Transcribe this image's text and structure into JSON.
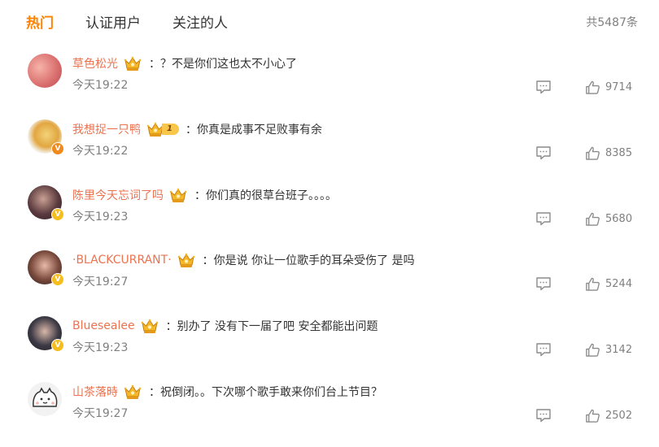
{
  "tabs": [
    {
      "label": "热门",
      "active": true
    },
    {
      "label": "认证用户",
      "active": false
    },
    {
      "label": "关注的人",
      "active": false
    }
  ],
  "total_count": "共5487条",
  "colors": {
    "accent": "#ff8200",
    "username": "#eb7350",
    "muted": "#808080"
  },
  "comments": [
    {
      "username": "草色松光",
      "badge": "crown-icon",
      "text": "？不是你们这也太不小心了",
      "time": "今天19:22",
      "likes": "9714",
      "verified": ""
    },
    {
      "username": "我想捉一只鸭",
      "badge": "crown-level-icon",
      "level": "1",
      "text": "你真是成事不足败事有余",
      "time": "今天19:22",
      "likes": "8385",
      "verified": "orange"
    },
    {
      "username": "陈里今天忘词了吗",
      "badge": "crown-icon",
      "text": "你们真的很草台班子。。。。",
      "time": "今天19:23",
      "likes": "5680",
      "verified": "yellow"
    },
    {
      "username": "·BLACKCURRANT·",
      "badge": "crown-icon",
      "text": "你是说 你让一位歌手的耳朵受伤了 是吗",
      "time": "今天19:27",
      "likes": "5244",
      "verified": "yellow"
    },
    {
      "username": "Bluesealee",
      "badge": "crown-icon",
      "text": "别办了 没有下一届了吧 安全都能出问题",
      "time": "今天19:23",
      "likes": "3142",
      "verified": "yellow"
    },
    {
      "username": "山茶落時",
      "badge": "crown-icon",
      "text": "祝倒闭。。下次哪个歌手敢来你们台上节目？",
      "time": "今天19:27",
      "likes": "2502",
      "verified": ""
    }
  ],
  "colon": "："
}
